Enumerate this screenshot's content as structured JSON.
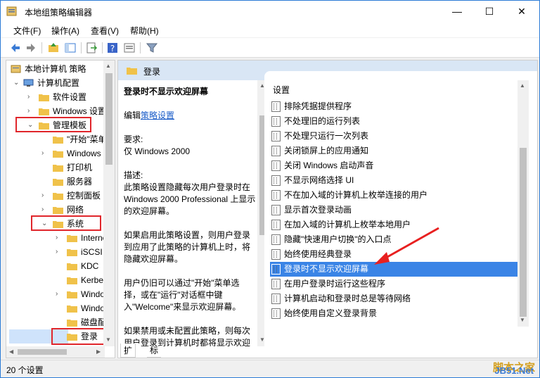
{
  "window": {
    "title": "本地组策略编辑器",
    "controls": {
      "minimize": "—",
      "maximize": "☐",
      "close": "✕"
    }
  },
  "menu": [
    "文件(F)",
    "操作(A)",
    "查看(V)",
    "帮助(H)"
  ],
  "toolbar": {
    "icons": [
      "back-icon",
      "forward-icon",
      "up-folder-icon",
      "show-tree-icon",
      "export-icon",
      "help-icon",
      "properties-icon",
      "filter-icon"
    ]
  },
  "tree": {
    "items": [
      {
        "label": "本地计算机 策略"
      },
      {
        "label": "计算机配置",
        "arrow": "⌄"
      },
      {
        "label": "软件设置",
        "arrow": "›"
      },
      {
        "label": "Windows 设置",
        "arrow": "›"
      },
      {
        "label": "管理模板",
        "arrow": "⌄"
      },
      {
        "label": "\"开始\"菜单",
        "arrow": ""
      },
      {
        "label": "Windows",
        "arrow": "›"
      },
      {
        "label": "打印机",
        "arrow": ""
      },
      {
        "label": "服务器",
        "arrow": ""
      },
      {
        "label": "控制面板",
        "arrow": "›"
      },
      {
        "label": "网络",
        "arrow": "›"
      },
      {
        "label": "系统",
        "arrow": "⌄"
      },
      {
        "label": "Internet",
        "arrow": "›"
      },
      {
        "label": "iSCSI",
        "arrow": "›"
      },
      {
        "label": "KDC",
        "arrow": ""
      },
      {
        "label": "Kerberos",
        "arrow": ""
      },
      {
        "label": "Windows",
        "arrow": "›"
      },
      {
        "label": "Windows",
        "arrow": ""
      },
      {
        "label": "磁盘配额",
        "arrow": ""
      },
      {
        "label": "登录",
        "arrow": ""
      }
    ]
  },
  "header": {
    "folder_label": "登录"
  },
  "description": {
    "title": "登录时不显示欢迎屏幕",
    "edit_prefix": "编辑",
    "edit_link": "策略设置",
    "req_label": "要求:",
    "req_value": "仅 Windows 2000",
    "desc_label": "描述:",
    "desc_text": "此策略设置隐藏每次用户登录时在 Windows 2000 Professional 上显示的欢迎屏幕。",
    "enabled_text": "如果启用此策略设置，则用户登录到应用了此策略的计算机上时，将隐藏欢迎屏幕。",
    "user_text": "用户仍旧可以通过\"开始\"菜单选择，或在\"运行\"对话框中键入\"Welcome\"来显示欢迎屏幕。",
    "disabled_text": "如果禁用或未配置此策略，则每次用户登录到计算机时都将显示欢迎"
  },
  "list": {
    "column": "设置",
    "items": [
      "排除凭据提供程序",
      "不处理旧的运行列表",
      "不处理只运行一次列表",
      "关闭锁屏上的应用通知",
      "关闭 Windows 启动声音",
      "不显示网络选择 UI",
      "不在加入域的计算机上枚举连接的用户",
      "显示首次登录动画",
      "在加入域的计算机上枚举本地用户",
      "隐藏\"快速用户切换\"的入口点",
      "始终使用经典登录",
      "登录时不显示欢迎屏幕",
      "在用户登录时运行这些程序",
      "计算机启动和登录时总是等待网络",
      "始终使用自定义登录背景"
    ],
    "selected_index": 11
  },
  "tabs": [
    "扩展",
    "标准"
  ],
  "status": "20 个设置",
  "watermark": {
    "line1": "脚本之家",
    "line2": "JB51.Net"
  },
  "colors": {
    "highlight": "#e0262b",
    "selection": "#3a84e6",
    "arrow": "#e82020"
  }
}
